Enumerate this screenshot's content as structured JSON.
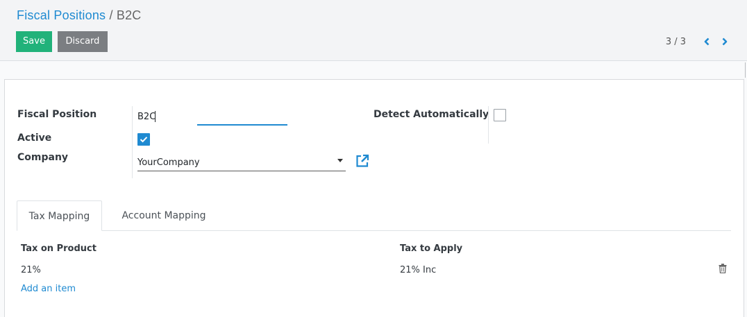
{
  "breadcrumb": {
    "parent": "Fiscal Positions",
    "separator": "/",
    "current": "B2C"
  },
  "toolbar": {
    "save_label": "Save",
    "discard_label": "Discard"
  },
  "pager": {
    "value": "3 / 3"
  },
  "form": {
    "fiscal_position_label": "Fiscal Position",
    "fiscal_position_value": "B2C",
    "active_label": "Active",
    "active_checked": true,
    "company_label": "Company",
    "company_value": "YourCompany",
    "detect_label": "Detect Automatically",
    "detect_checked": false
  },
  "tabs": [
    {
      "label": "Tax Mapping",
      "active": true
    },
    {
      "label": "Account Mapping",
      "active": false
    }
  ],
  "table": {
    "columns": [
      "Tax on Product",
      "Tax to Apply"
    ],
    "rows": [
      {
        "tax_on_product": "21%",
        "tax_to_apply": "21% Inc"
      }
    ],
    "add_item_label": "Add an item"
  },
  "colors": {
    "accent": "#1f8ad1",
    "save": "#21b27a",
    "discard": "#7b7e82"
  },
  "icons": [
    "chevron-left-icon",
    "chevron-right-icon",
    "checkmark-icon",
    "caret-down-icon",
    "external-link-icon",
    "trash-icon"
  ]
}
